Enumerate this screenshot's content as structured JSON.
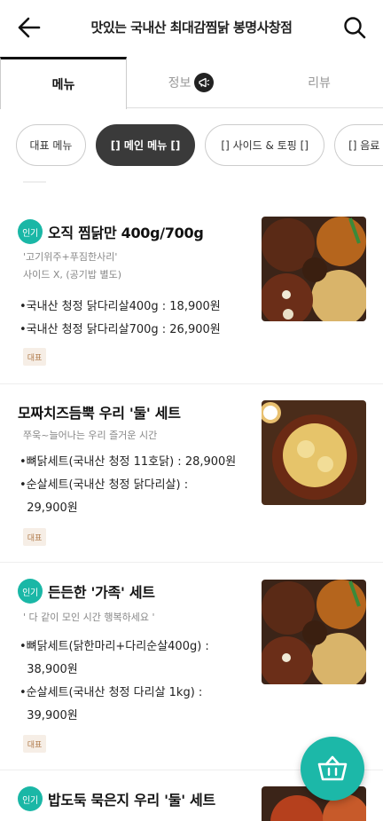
{
  "header": {
    "title": "맛있는 국내산 최대감찜닭 봉명사창점",
    "back_icon": "arrow-left-icon",
    "search_icon": "search-icon"
  },
  "tabs": [
    {
      "label": "메뉴",
      "active": true
    },
    {
      "label": "정보",
      "active": false,
      "icon": "megaphone-icon"
    },
    {
      "label": "리뷰",
      "active": false
    }
  ],
  "chips": [
    {
      "label": "대표 메뉴",
      "active": false
    },
    {
      "label": "[] 메인 메뉴 []",
      "active": true
    },
    {
      "label": "[] 사이드 & 토핑 []",
      "active": false
    },
    {
      "label": "[] 음료 []",
      "active": false
    }
  ],
  "badge_popular": "인기",
  "tag_representative": "대표",
  "menu": [
    {
      "name": "오직 찜닭만 400g/700g",
      "popular": true,
      "desc": [
        "'고기위주+푸짐한사리'",
        "사이드 X, (공기밥 별도)"
      ],
      "lines": [
        "•국내산 청정 닭다리살400g : 18,900원",
        "•국내산 청정 닭다리살700g : 26,900원"
      ],
      "representative": true
    },
    {
      "name": "모짜치즈듬뿍 우리 '둘' 세트",
      "popular": false,
      "desc": [
        "쭈욱~늘어나는 우리  즐거운 시간"
      ],
      "lines": [
        "•뼈닭세트(국내산 청정 11호닭) : 28,900원",
        "•순살세트(국내산 청정 닭다리살) :",
        "  29,900원"
      ],
      "representative": true
    },
    {
      "name": "든든한 '가족' 세트",
      "popular": true,
      "desc": [
        "' 다 같이 모인 시간 행복하세요 '"
      ],
      "lines": [
        "•뼈닭세트(닭한마리+다리순살400g) :",
        "  38,900원",
        "•순살세트(국내산 청정 다리살 1kg) :",
        "  39,900원"
      ],
      "representative": true
    },
    {
      "name": "밥도둑 묵은지 우리 '둘' 세트",
      "popular": true,
      "desc": [],
      "lines": [],
      "representative": false
    }
  ],
  "cart_icon": "basket-icon",
  "colors": {
    "accent": "#1cb8a8",
    "badge": "#1ab7a6",
    "chip_active": "#3a3a3a",
    "tag_bg": "#f6eee6"
  }
}
